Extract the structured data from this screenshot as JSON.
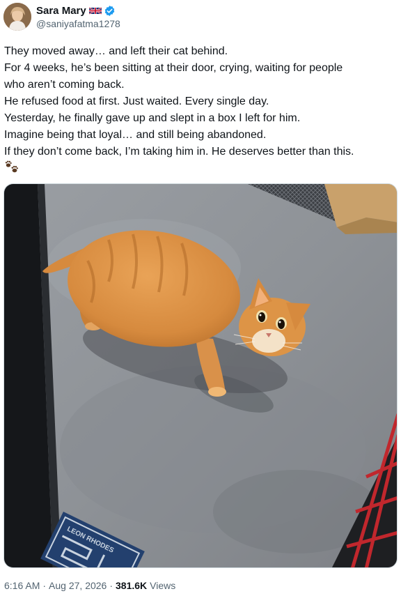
{
  "author": {
    "display_name": "Sara Mary",
    "handle": "@saniyafatma1278",
    "flag_icon": "uk-flag-icon",
    "verified_icon": "verified-badge-icon",
    "verified_color": "#1d9bf0"
  },
  "tweet": {
    "lines": [
      "They moved away… and left their cat behind.",
      "For 4 weeks, he’s been sitting at their door, crying, waiting for people",
      "who aren’t coming back.",
      "He refused food at first. Just waited. Every single day.",
      "Yesterday, he finally gave up and slept in a box I left for him.",
      "Imagine being that loyal… and still being abandoned.",
      "If they don’t come back, I’m taking him in. He deserves better than this."
    ],
    "emoji_icon": "paw-prints-icon"
  },
  "media": {
    "description_icon": "photo-orange-cat",
    "doormat_text": "LEON RHODES"
  },
  "meta": {
    "time": "6:16 AM",
    "date": "Aug 27, 2026",
    "views_count": "381.6K",
    "views_label": "Views",
    "separator": "·"
  },
  "colors": {
    "text_primary": "#0f1419",
    "text_secondary": "#536471",
    "border": "#cfd9de"
  }
}
